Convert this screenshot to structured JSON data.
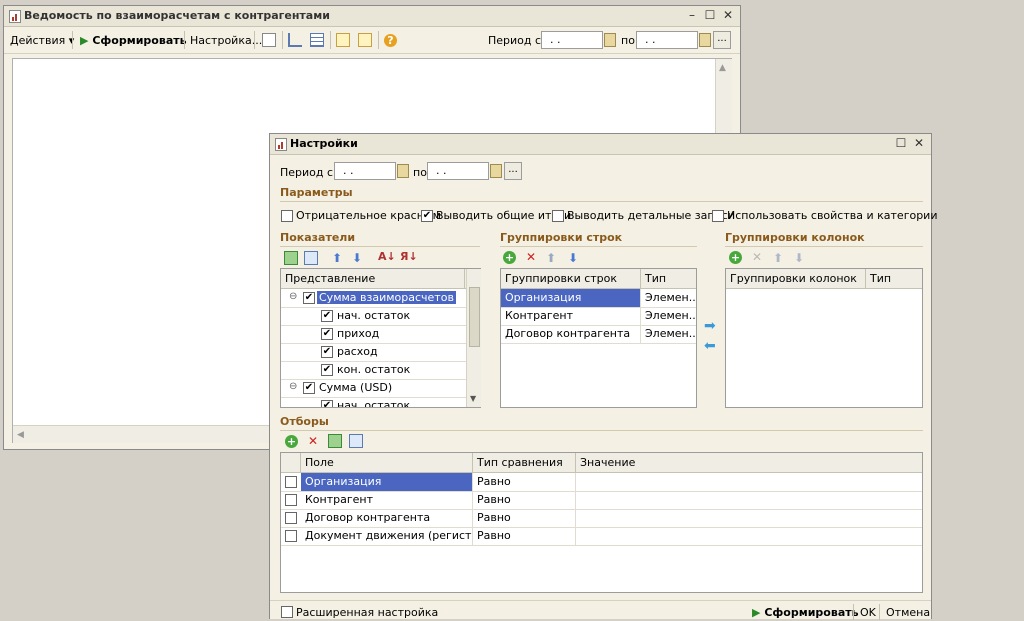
{
  "main_window": {
    "title": "Ведомость по взаиморасчетам с контрагентами",
    "toolbar": {
      "actions_label": "Действия",
      "form_label": "Сформировать",
      "settings_label": "Настройка...",
      "period_from_label": "Период с:",
      "period_to_label": "по",
      "date_from": " .  .",
      "date_to": " .  .",
      "more_label": "..."
    }
  },
  "settings_dialog": {
    "title": "Настройки",
    "period_from_label": "Период с:",
    "period_to_label": "по",
    "date_from": " .  .",
    "date_to": " .  .",
    "more_label": "...",
    "parameters": {
      "section_title": "Параметры",
      "options": [
        {
          "label": "Отрицательное красным",
          "checked": false
        },
        {
          "label": "Выводить общие итоги",
          "checked": true
        },
        {
          "label": "Выводить детальные записи",
          "checked": false
        },
        {
          "label": "Использовать свойства и категории",
          "checked": false
        }
      ]
    },
    "indicators": {
      "section_title": "Показатели",
      "column_header": "Представление",
      "rows": [
        {
          "label": "Сумма взаиморасчетов",
          "checked": true,
          "level": 0,
          "selected": true
        },
        {
          "label": "нач. остаток",
          "checked": true,
          "level": 1
        },
        {
          "label": "приход",
          "checked": true,
          "level": 1
        },
        {
          "label": "расход",
          "checked": true,
          "level": 1
        },
        {
          "label": "кон. остаток",
          "checked": true,
          "level": 1
        },
        {
          "label": "Сумма (USD)",
          "checked": true,
          "level": 0
        },
        {
          "label": "нач. остаток",
          "checked": true,
          "level": 1
        }
      ]
    },
    "row_groupings": {
      "section_title": "Группировки строк",
      "headers": [
        "Группировки строк",
        "Тип"
      ],
      "rows": [
        {
          "name": "Организация",
          "type": "Элемен...",
          "selected": true
        },
        {
          "name": "Контрагент",
          "type": "Элемен..."
        },
        {
          "name": "Договор контрагента",
          "type": "Элемен..."
        }
      ]
    },
    "column_groupings": {
      "section_title": "Группировки колонок",
      "headers": [
        "Группировки колонок",
        "Тип"
      ]
    },
    "filters": {
      "section_title": "Отборы",
      "headers": [
        "Поле",
        "Тип сравнения",
        "Значение"
      ],
      "rows": [
        {
          "field": "Организация",
          "comparison": "Равно",
          "value": "",
          "selected": true
        },
        {
          "field": "Контрагент",
          "comparison": "Равно",
          "value": ""
        },
        {
          "field": "Договор контрагента",
          "comparison": "Равно",
          "value": ""
        },
        {
          "field": "Документ движения (регистрат...",
          "comparison": "Равно",
          "value": ""
        }
      ]
    },
    "footer": {
      "extended_label": "Расширенная настройка",
      "form_label": "Сформировать",
      "ok_label": "OK",
      "cancel_label": "Отмена"
    }
  }
}
